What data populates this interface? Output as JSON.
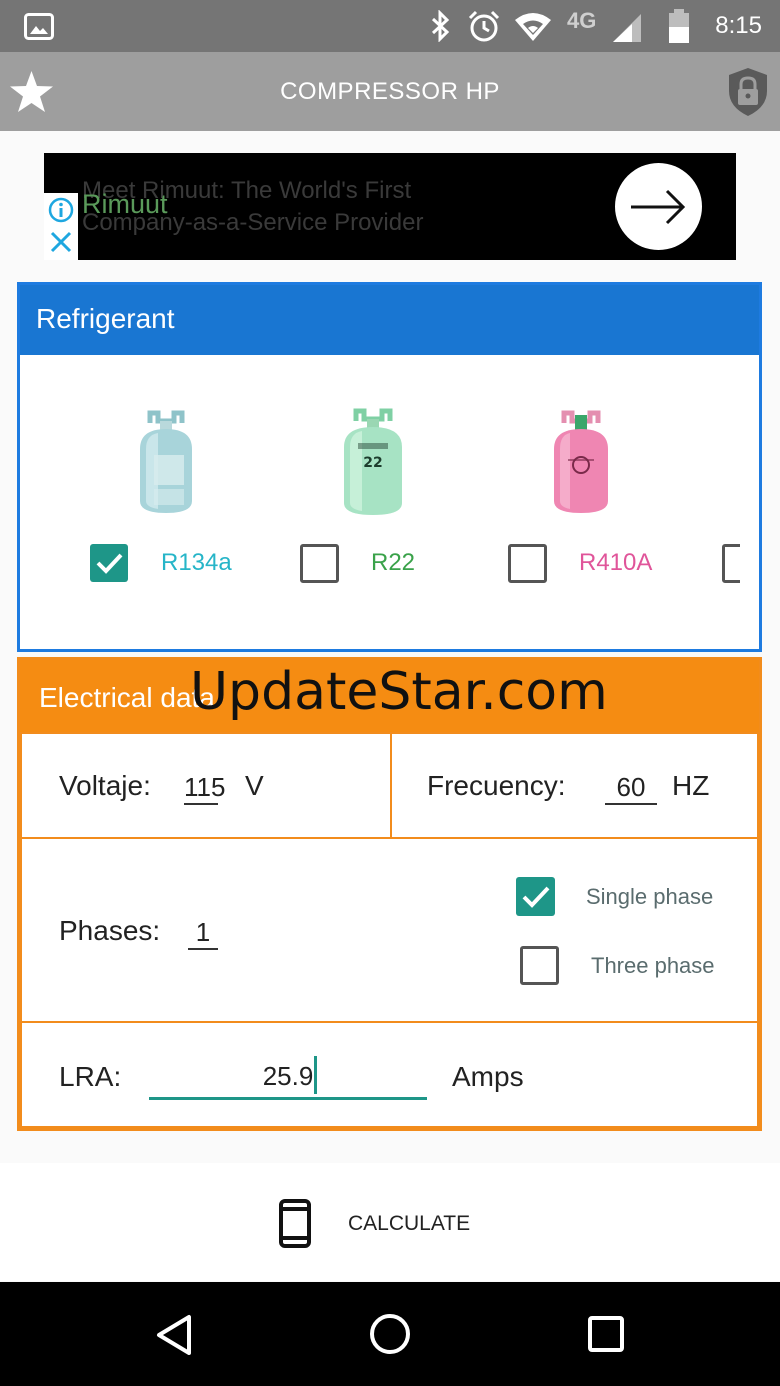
{
  "status_bar": {
    "time": "8:15",
    "network": "4G"
  },
  "app_bar": {
    "title": "COMPRESSOR HP"
  },
  "ad": {
    "headline_line1": "Meet Rimuut: The World's First",
    "headline_line2": "Company-as-a-Service Provider",
    "brand": "Rimuut"
  },
  "refrigerant": {
    "header": "Refrigerant",
    "options": [
      {
        "label": "R134a",
        "checked": true,
        "color": "#26b5c8"
      },
      {
        "label": "R22",
        "checked": false,
        "color": "#3aa24a"
      },
      {
        "label": "R410A",
        "checked": false,
        "color": "#e0559a"
      }
    ],
    "cylinder_22_text": "22"
  },
  "electrical": {
    "header": "Electrical data",
    "voltage_label": "Voltaje:",
    "voltage_value": "115",
    "voltage_unit": "V",
    "frequency_label": "Frecuency:",
    "frequency_value": "60",
    "frequency_unit": "HZ",
    "phases_label": "Phases:",
    "phases_value": "1",
    "single_phase_label": "Single phase",
    "single_phase_checked": true,
    "three_phase_label": "Three phase",
    "three_phase_checked": false,
    "lra_label": "LRA:",
    "lra_value": "25.9",
    "lra_unit": "Amps"
  },
  "watermark": "UpdateStar.com",
  "calculate_label": "CALCULATE",
  "colors": {
    "refrigerant_header": "#1976d2",
    "electrical_header": "#f58c12",
    "accent": "#1e9688"
  }
}
